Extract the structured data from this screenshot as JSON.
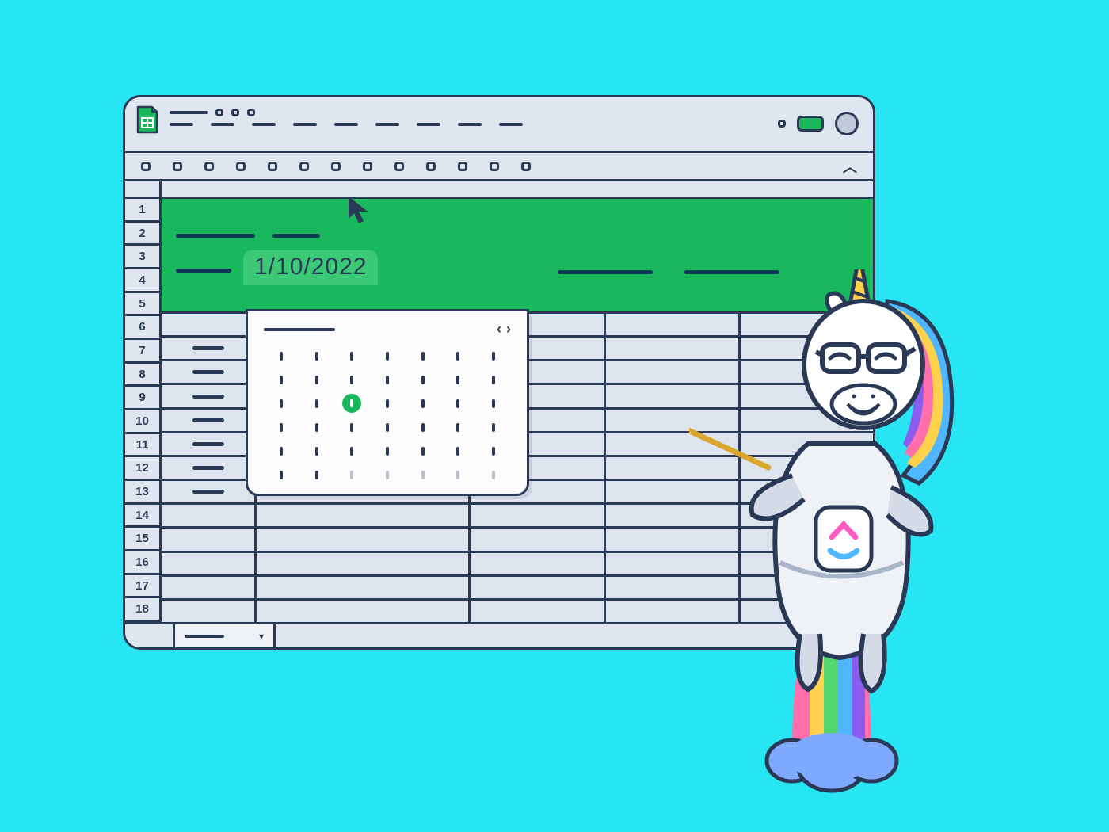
{
  "app": {
    "name": "Google Sheets"
  },
  "toolbar": {
    "items_count": 13
  },
  "grid": {
    "row_numbers": [
      "1",
      "2",
      "3",
      "4",
      "5",
      "6",
      "7",
      "8",
      "9",
      "10",
      "11",
      "12",
      "13",
      "14",
      "15",
      "16",
      "17",
      "18"
    ],
    "visible_rows": 18,
    "header_rows_green": 5
  },
  "date_cell": {
    "value": "1/10/2022"
  },
  "calendar": {
    "nav_prev": "‹",
    "nav_next": "›",
    "selected_row": 2,
    "selected_col": 2,
    "rows": 6,
    "cols": 7,
    "trailing_grey_start": 37
  },
  "sheet_tab": {
    "dropdown_glyph": "▾"
  },
  "colors": {
    "accent_green": "#19b85c",
    "outline": "#2a3a56",
    "bg": "#27e5f2",
    "chrome": "#e0e6ef"
  },
  "mascot": {
    "name": "ClickUp Unicorn",
    "action": "pointing"
  }
}
